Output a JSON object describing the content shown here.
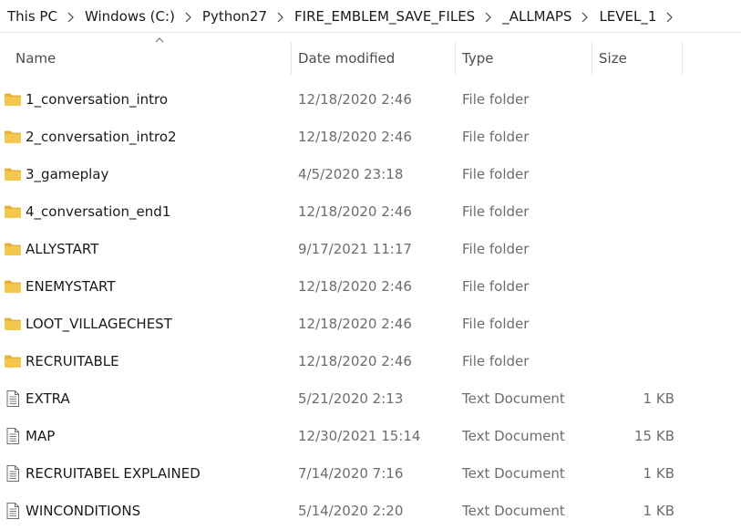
{
  "breadcrumb": [
    "This PC",
    "Windows (C:)",
    "Python27",
    "FIRE_EMBLEM_SAVE_FILES",
    "_ALLMAPS",
    "LEVEL_1"
  ],
  "columns": {
    "name": "Name",
    "date": "Date modified",
    "type": "Type",
    "size": "Size"
  },
  "colors": {
    "folder": "#f4c74f",
    "folder_dark": "#e8b13a",
    "doc_outline": "#6e6e6e"
  },
  "files": [
    {
      "name": "1_conversation_intro",
      "date": "12/18/2020 2:46",
      "type": "File folder",
      "size": "",
      "icon": "folder-icon"
    },
    {
      "name": "2_conversation_intro2",
      "date": "12/18/2020 2:46",
      "type": "File folder",
      "size": "",
      "icon": "folder-icon"
    },
    {
      "name": "3_gameplay",
      "date": "4/5/2020 23:18",
      "type": "File folder",
      "size": "",
      "icon": "folder-icon"
    },
    {
      "name": "4_conversation_end1",
      "date": "12/18/2020 2:46",
      "type": "File folder",
      "size": "",
      "icon": "folder-icon"
    },
    {
      "name": "ALLYSTART",
      "date": "9/17/2021 11:17",
      "type": "File folder",
      "size": "",
      "icon": "folder-icon"
    },
    {
      "name": "ENEMYSTART",
      "date": "12/18/2020 2:46",
      "type": "File folder",
      "size": "",
      "icon": "folder-icon"
    },
    {
      "name": "LOOT_VILLAGECHEST",
      "date": "12/18/2020 2:46",
      "type": "File folder",
      "size": "",
      "icon": "folder-icon"
    },
    {
      "name": "RECRUITABLE",
      "date": "12/18/2020 2:46",
      "type": "File folder",
      "size": "",
      "icon": "folder-icon"
    },
    {
      "name": "EXTRA",
      "date": "5/21/2020 2:13",
      "type": "Text Document",
      "size": "1 KB",
      "icon": "text-document-icon"
    },
    {
      "name": "MAP",
      "date": "12/30/2021 15:14",
      "type": "Text Document",
      "size": "15 KB",
      "icon": "text-document-icon"
    },
    {
      "name": "RECRUITABEL EXPLAINED",
      "date": "7/14/2020 7:16",
      "type": "Text Document",
      "size": "1 KB",
      "icon": "text-document-icon"
    },
    {
      "name": "WINCONDITIONS",
      "date": "5/14/2020 2:20",
      "type": "Text Document",
      "size": "1 KB",
      "icon": "text-document-icon"
    }
  ]
}
